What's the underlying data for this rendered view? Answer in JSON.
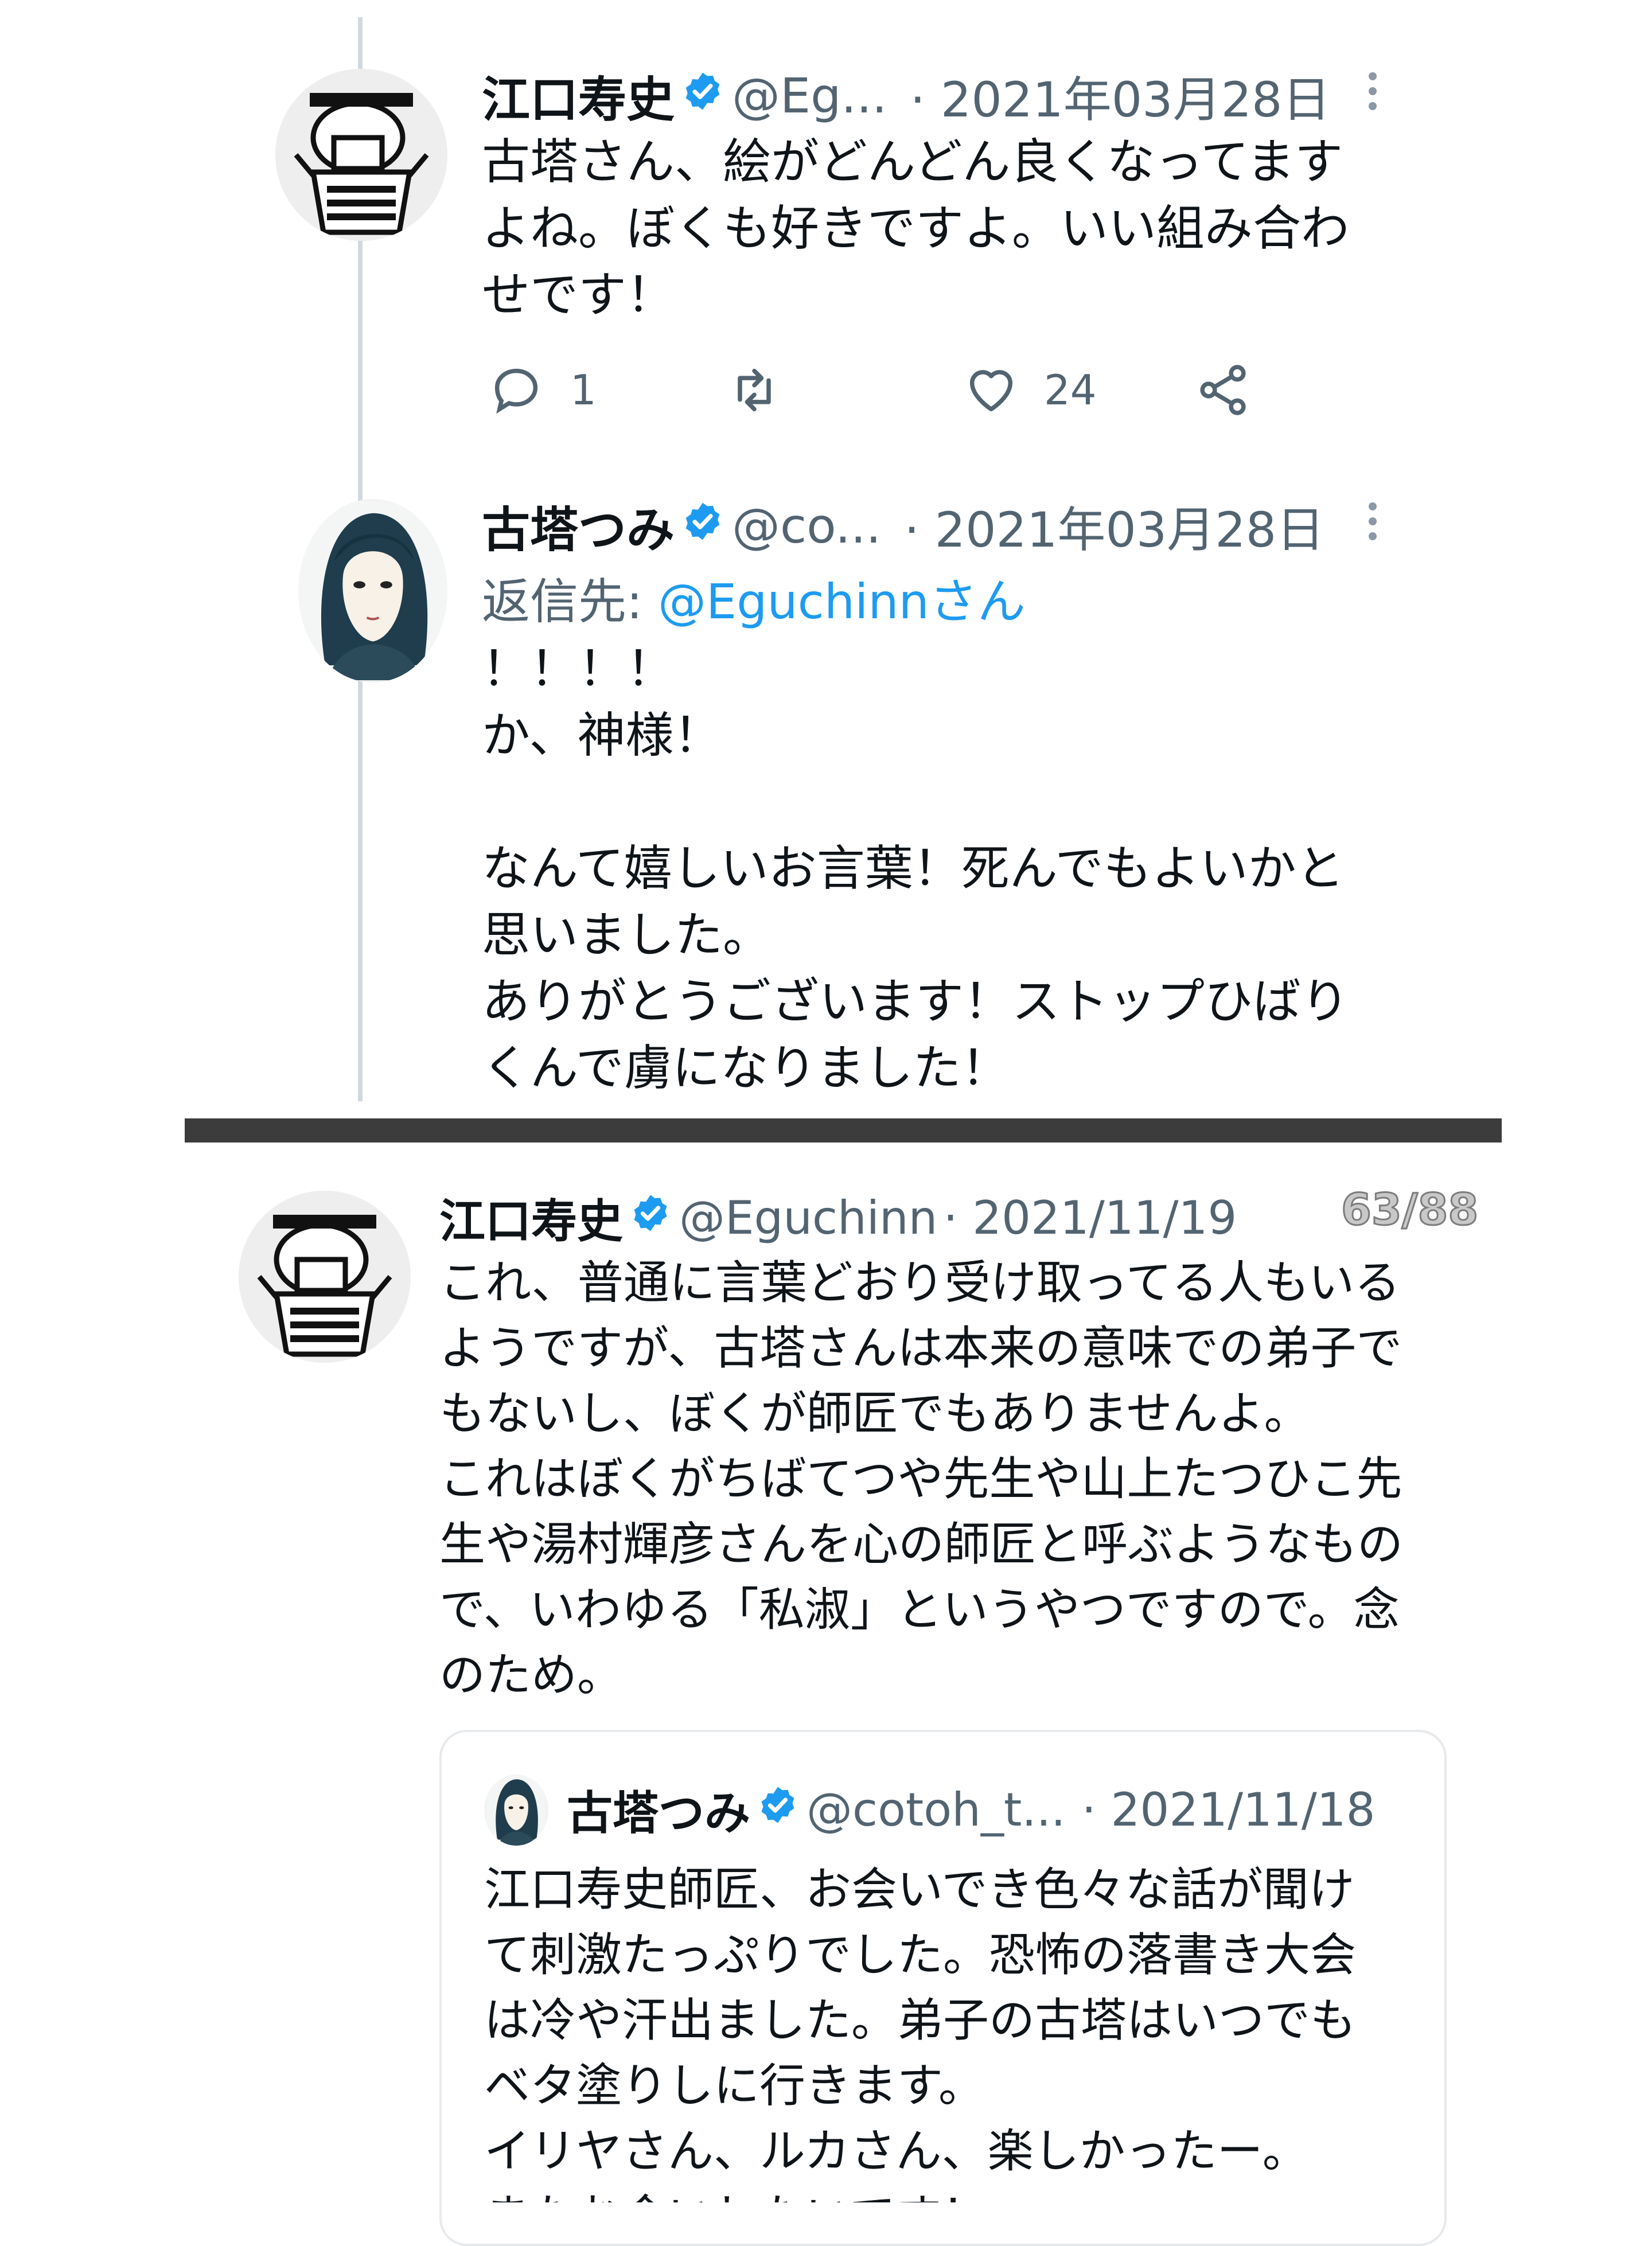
{
  "tweets": [
    {
      "author": "江口寿史",
      "handle": "@Eg...",
      "date": "· 2021年03月28日",
      "text": "古塔さん、絵がどんどん良くなってます\nよね。ぼくも好きですよ。いい組み合わ\nせです！",
      "reply_count": "1",
      "like_count": "24"
    },
    {
      "author": "古塔つみ",
      "handle": "@co...",
      "date": "· 2021年03月28日",
      "reply_prefix": "返信先:",
      "reply_to": "@Eguchinnさん",
      "text": "！！！！\nか、神様！\n\nなんて嬉しいお言葉！死んでもよいかと\n思いました。\nありがとうございます！ストップひばり\nくんで虜になりました！"
    }
  ],
  "second": {
    "author": "江口寿史",
    "handle": "@Eguchinn",
    "date": "· 2021/11/19",
    "counter": "63/88",
    "text": "これ、普通に言葉どおり受け取ってる人もいる\nようですが、古塔さんは本来の意味での弟子で\nもないし、ぼくが師匠でもありませんよ。\nこれはぼくがちばてつや先生や山上たつひこ先\n生や湯村輝彦さんを心の師匠と呼ぶようなもの\nで、いわゆる「私淑」というやつですので。念\nのため。",
    "quote": {
      "author": "古塔つみ",
      "handle": "@cotoh_t...",
      "date": "· 2021/11/18",
      "text": "江口寿史師匠、お会いでき色々な話が聞け\nて刺激たっぷりでした。恐怖の落書き大会\nは冷や汗出ました。弟子の古塔はいつでも\nベタ塗りしに行きます。\nイリヤさん、ルカさん、楽しかったー。\nまたお会いしたいです！"
    }
  },
  "colors": {
    "verified": "#1d9bf0",
    "text": "#0f1419",
    "secondary": "#536471",
    "link": "#1d9bf0",
    "divider": "#3c3c3c"
  }
}
